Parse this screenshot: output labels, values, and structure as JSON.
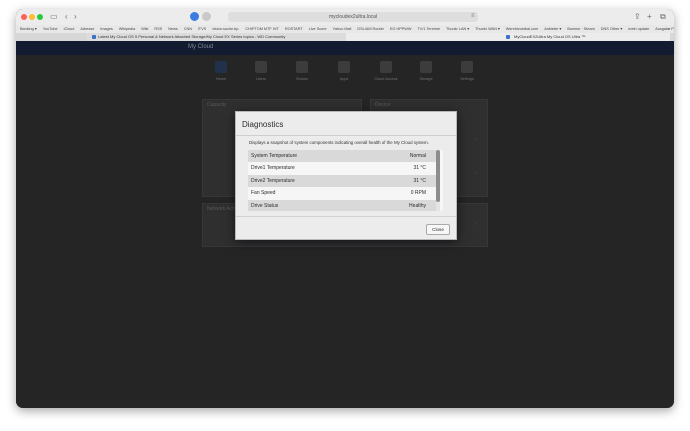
{
  "browser": {
    "address": "mycloudex2ultra.local",
    "bookmarks": [
      "Banking ▾",
      "YouTube",
      "iCloud",
      "Adresse",
      "Images",
      "Wikipedia",
      "Wiki",
      "RSS",
      "News",
      "CNN",
      "iTVS",
      "vision.suche.bp.",
      "CHIPTOM MTF HIT",
      "ROSTART",
      "Live Score",
      "Yahoo Mail",
      "DSL/AM Router",
      "EG HPPWW",
      "TV/1 Termine",
      "Thunkr LAN ▾",
      "Thunkr WAN ▾",
      "Wereldvoetbal.com",
      "Anbieter ▾",
      "Bomme · Steam",
      "DNS Other ▾",
      "mein update",
      "Ausgabe Podcaster"
    ],
    "bookmarks_more": "»",
    "tabs": [
      {
        "title": "Latest My Cloud OS 5 Personal & Network Attached Storage/My Cloud EX Series topics - WD Community"
      },
      {
        "title": "MyCloudEX2Ultra My Cloud OS Ultra ™"
      }
    ]
  },
  "app": {
    "logo": "My Cloud",
    "nav": [
      {
        "label": "Home",
        "icon": "home-icon",
        "active": true
      },
      {
        "label": "Users",
        "icon": "users-icon",
        "active": false
      },
      {
        "label": "Shares",
        "icon": "shares-icon",
        "active": false
      },
      {
        "label": "Apps",
        "icon": "apps-icon",
        "active": false
      },
      {
        "label": "Cloud Access",
        "icon": "cloud-access-icon",
        "active": false
      },
      {
        "label": "Storage",
        "icon": "storage-icon",
        "active": false
      },
      {
        "label": "Settings",
        "icon": "settings-icon",
        "active": false
      }
    ],
    "panels": {
      "capacity": "Capacity",
      "device": "Device",
      "network": "Network Activity"
    }
  },
  "dialog": {
    "title": "Diagnostics",
    "description": "Displays a snapshot of system components indicating overall health of the My Cloud system.",
    "rows": [
      {
        "name": "System Temperature",
        "value": "Normal"
      },
      {
        "name": "Drive1 Temperature",
        "value": "31 °C"
      },
      {
        "name": "Drive2 Temperature",
        "value": "31 °C"
      },
      {
        "name": "Fan Speed",
        "value": "0 RPM"
      },
      {
        "name": "Drive Status",
        "value": "Healthy"
      }
    ],
    "close_label": "Close"
  },
  "colors": {
    "page_dark": "#2e2e2f",
    "header_navy": "#16223a",
    "dialog_bg": "#ececec"
  }
}
